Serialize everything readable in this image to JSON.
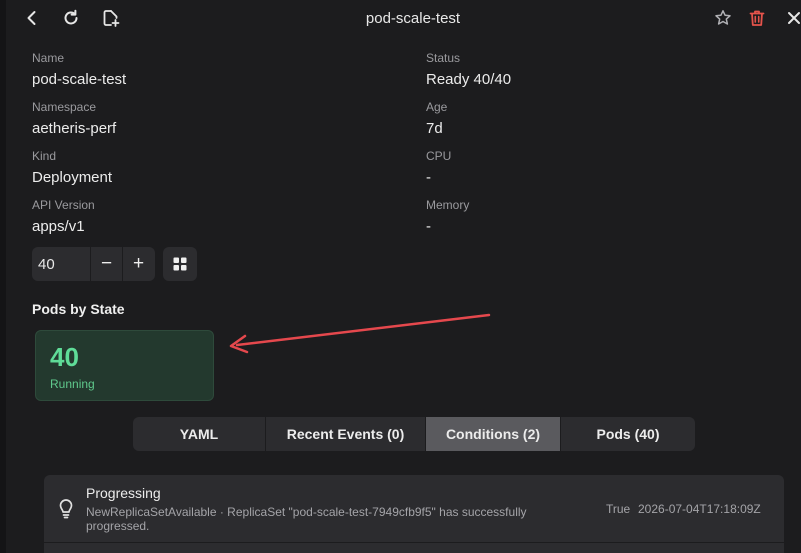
{
  "header": {
    "title": "pod-scale-test",
    "icons": [
      "back-icon",
      "refresh-icon",
      "add-file-icon",
      "star-icon",
      "trash-icon",
      "close-icon"
    ],
    "danger_color": "#e5534b"
  },
  "fields": {
    "name_label": "Name",
    "name_value": "pod-scale-test",
    "namespace_label": "Namespace",
    "namespace_value": "aetheris-perf",
    "kind_label": "Kind",
    "kind_value": "Deployment",
    "api_label": "API Version",
    "api_value": "apps/v1",
    "status_label": "Status",
    "status_value": "Ready 40/40",
    "age_label": "Age",
    "age_value": "7d",
    "cpu_label": "CPU",
    "cpu_value": "-",
    "memory_label": "Memory",
    "memory_value": "-"
  },
  "scale": {
    "value": "40",
    "decrement_label": "−",
    "increment_label": "+",
    "grid_icon": "grid-icon"
  },
  "pods_by_state": {
    "title": "Pods by State",
    "count": "40",
    "state": "Running",
    "color": "#5fdc98"
  },
  "tabs": [
    {
      "label": "YAML"
    },
    {
      "label": "Recent Events (0)"
    },
    {
      "label": "Conditions (2)"
    },
    {
      "label": "Pods (40)"
    }
  ],
  "active_tab": "Conditions (2)",
  "conditions": [
    {
      "type": "Progressing",
      "message": "NewReplicaSetAvailable · ReplicaSet \"pod-scale-test-7949cfb9f5\" has successfully progressed.",
      "status": "True",
      "time": "2026-07-04T17:18:09Z",
      "icon": "lightbulb-icon"
    }
  ],
  "annotation": {
    "arrow_color": "#e5484d"
  }
}
